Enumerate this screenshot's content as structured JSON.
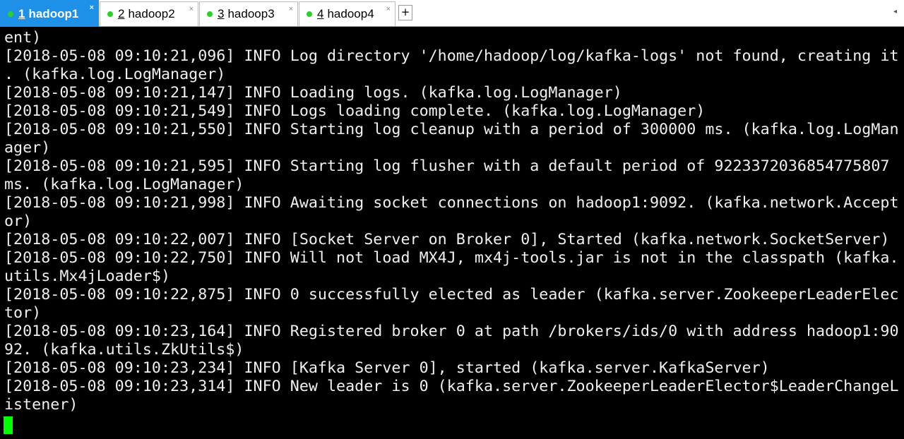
{
  "tabs": [
    {
      "number": "1",
      "title": "hadoop1",
      "active": true,
      "close": "×"
    },
    {
      "number": "2",
      "title": "hadoop2",
      "active": false,
      "close": "×"
    },
    {
      "number": "3",
      "title": "hadoop3",
      "active": false,
      "close": "×"
    },
    {
      "number": "4",
      "title": "hadoop4",
      "active": false,
      "close": "×"
    }
  ],
  "new_tab_label": "+",
  "tab_menu_icon": "◂",
  "colors": {
    "active_tab": "#1e90e8",
    "status_dot": "#2bd12b",
    "terminal_bg": "#000000",
    "terminal_text": "#f0f0f0",
    "cursor": "#00ff00"
  },
  "terminal": {
    "lines": [
      "ent)",
      "[2018-05-08 09:10:21,096] INFO Log directory '/home/hadoop/log/kafka-logs' not found, creating it",
      ". (kafka.log.LogManager)",
      "[2018-05-08 09:10:21,147] INFO Loading logs. (kafka.log.LogManager)",
      "[2018-05-08 09:10:21,549] INFO Logs loading complete. (kafka.log.LogManager)",
      "[2018-05-08 09:10:21,550] INFO Starting log cleanup with a period of 300000 ms. (kafka.log.LogMan",
      "ager)",
      "[2018-05-08 09:10:21,595] INFO Starting log flusher with a default period of 9223372036854775807",
      "ms. (kafka.log.LogManager)",
      "[2018-05-08 09:10:21,998] INFO Awaiting socket connections on hadoop1:9092. (kafka.network.Accept",
      "or)",
      "[2018-05-08 09:10:22,007] INFO [Socket Server on Broker 0], Started (kafka.network.SocketServer)",
      "[2018-05-08 09:10:22,750] INFO Will not load MX4J, mx4j-tools.jar is not in the classpath (kafka.",
      "utils.Mx4jLoader$)",
      "[2018-05-08 09:10:22,875] INFO 0 successfully elected as leader (kafka.server.ZookeeperLeaderElec",
      "tor)",
      "[2018-05-08 09:10:23,164] INFO Registered broker 0 at path /brokers/ids/0 with address hadoop1:90",
      "92. (kafka.utils.ZkUtils$)",
      "[2018-05-08 09:10:23,234] INFO [Kafka Server 0], started (kafka.server.KafkaServer)",
      "[2018-05-08 09:10:23,314] INFO New leader is 0 (kafka.server.ZookeeperLeaderElector$LeaderChangeL",
      "istener)"
    ]
  }
}
